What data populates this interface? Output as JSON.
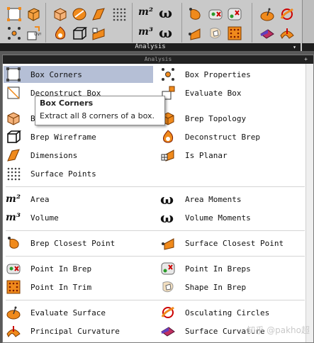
{
  "toolbar": {
    "section_label": "Analysis",
    "dropdown_symbol": "▾"
  },
  "panel": {
    "header_label": "Analysis",
    "pin_symbol": "+"
  },
  "tooltip": {
    "title": "Box Corners",
    "description": "Extract all 8 corners of a box."
  },
  "items": [
    {
      "label": "Box Corners",
      "icon": "box-corners-icon",
      "selected": true
    },
    {
      "label": "Box Properties",
      "icon": "box-properties-icon"
    },
    {
      "label": "Deconstruct Box",
      "icon": "deconstruct-box-icon"
    },
    {
      "label": "Evaluate Box",
      "icon": "evaluate-box-icon"
    },
    {
      "label": "B",
      "icon": "brep-edges-icon"
    },
    {
      "label": "Brep Topology",
      "icon": "brep-topology-icon"
    },
    {
      "label": "Brep Wireframe",
      "icon": "brep-wireframe-icon"
    },
    {
      "label": "Deconstruct Brep",
      "icon": "deconstruct-brep-icon"
    },
    {
      "label": "Dimensions",
      "icon": "dimensions-icon"
    },
    {
      "label": "Is Planar",
      "icon": "is-planar-icon"
    },
    {
      "label": "Surface Points",
      "icon": "surface-points-icon"
    },
    {
      "label": "Area",
      "icon": "area-icon"
    },
    {
      "label": "Area Moments",
      "icon": "area-moments-icon"
    },
    {
      "label": "Volume",
      "icon": "volume-icon"
    },
    {
      "label": "Volume Moments",
      "icon": "volume-moments-icon"
    },
    {
      "label": "Brep Closest Point",
      "icon": "brep-closest-point-icon"
    },
    {
      "label": "Surface Closest Point",
      "icon": "surface-closest-point-icon"
    },
    {
      "label": "Point In Brep",
      "icon": "point-in-brep-icon"
    },
    {
      "label": "Point In Breps",
      "icon": "point-in-breps-icon"
    },
    {
      "label": "Point In Trim",
      "icon": "point-in-trim-icon"
    },
    {
      "label": "Shape In Brep",
      "icon": "shape-in-brep-icon"
    },
    {
      "label": "Evaluate Surface",
      "icon": "evaluate-surface-icon"
    },
    {
      "label": "Osculating Circles",
      "icon": "osculating-circles-icon"
    },
    {
      "label": "Principal Curvature",
      "icon": "principal-curvature-icon"
    },
    {
      "label": "Surface Curvature",
      "icon": "surface-curvature-icon"
    }
  ],
  "icon_glyphs": {
    "area": "m²",
    "volume": "m³",
    "omega": "ω"
  },
  "watermark": "知乎 @pakho超",
  "colors": {
    "orange": "#f08a1c",
    "selected_row": "#b5bfd6",
    "toolbar_bg": "#c9c9c9"
  }
}
